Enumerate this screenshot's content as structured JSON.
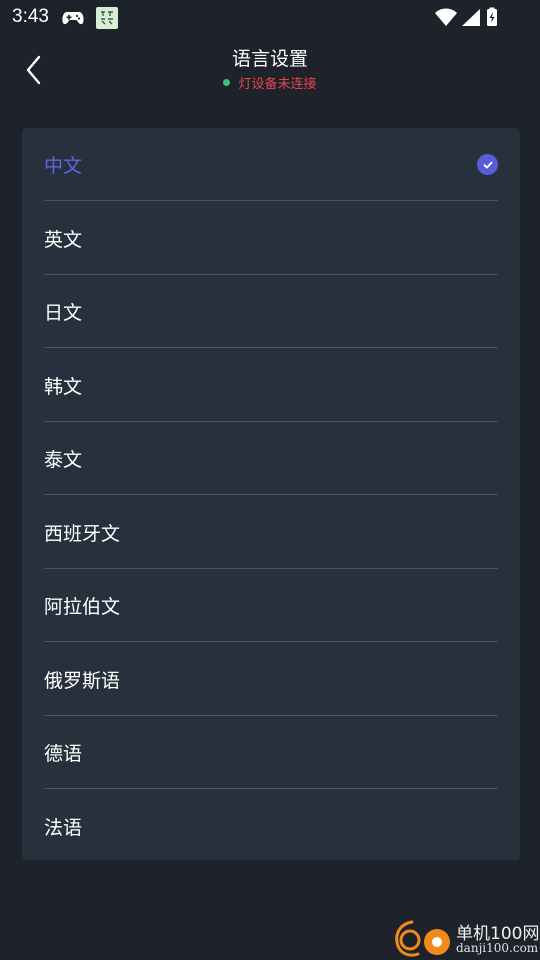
{
  "status_bar": {
    "time": "3:43",
    "icons": [
      "gamepad-icon",
      "app-notification-icon",
      "wifi-icon",
      "signal-icon",
      "battery-charging-icon"
    ]
  },
  "header": {
    "back_icon": "chevron-left-icon",
    "title": "语言设置",
    "connection_status": "灯设备未连接",
    "connection_dot_color": "#3cc27a",
    "connection_text_color": "#e8434e"
  },
  "languages": {
    "items": [
      {
        "label": "中文",
        "selected": true
      },
      {
        "label": "英文",
        "selected": false
      },
      {
        "label": "日文",
        "selected": false
      },
      {
        "label": "韩文",
        "selected": false
      },
      {
        "label": "泰文",
        "selected": false
      },
      {
        "label": "西班牙文",
        "selected": false
      },
      {
        "label": "阿拉伯文",
        "selected": false
      },
      {
        "label": "俄罗斯语",
        "selected": false
      },
      {
        "label": "德语",
        "selected": false
      },
      {
        "label": "法语",
        "selected": false
      }
    ],
    "selected_color": "#6065e0",
    "check_icon": "check-circle-icon"
  },
  "watermark": {
    "title": "单机100网",
    "url": "danji100.com"
  },
  "colors": {
    "background": "#1e232b",
    "card": "#27313e",
    "divider": "#4a5461"
  }
}
